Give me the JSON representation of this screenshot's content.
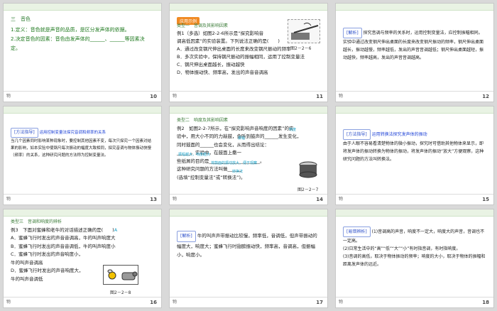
{
  "slides": [
    {
      "num": "10",
      "foot": "物",
      "section": "三　音色",
      "lines": [
        "1.定义：音色就是声音的品质，是区分发声体的依据。",
        "2.决定音色的因素：音色由发声体的______、______等因素决定。"
      ]
    },
    {
      "num": "11",
      "foot": "物",
      "tag": "应用示例",
      "subtitle": "类型一　音调及其影响因素",
      "lines": [
        "例1（多选）如图2-2-6所示是“探究影响音",
        "调高低因素”的实验装置。下列说法正确的是(　　)",
        "A．通过改变钢尺伸出桌面的长度来改变钢尺振动的频率",
        "B．多次实验中，保持钢尺振动的振幅相同，运用了控制变量法",
        "C．钢尺伸出桌面越长，振动越快",
        "D．物体振动快、频率高，发出的声音音调高"
      ],
      "figure_label": "图2－2－6"
    },
    {
      "num": "12",
      "foot": "物",
      "label": "[解析]",
      "text": "探究音调与频率的关系时，运用控制变量法，应控制振幅相同。实验中通过改变钢尺伸出桌面的长度来改变钢尺振动的频率，钢尺伸出桌面越长，振动越慢，频率越低，发出的声音音调越低；钢尺伸出桌面越短，振动越快，频率越高，发出的声音音调越高。"
    },
    {
      "num": "13",
      "foot": "物",
      "label": "[方法指导]",
      "title": "运用控制变量法探究音调和频率的关系",
      "text": "当几个因素同时影响某种现象时，要控制其他因素不变，每次只探究一个因素对结果的影响，如本实验中使钢尺每次振动的幅度大致相同，探究音调与物体振动快慢（频率）的关系，这种研究问题的方法称为控制变量法。"
    },
    {
      "num": "14",
      "foot": "物",
      "subtitle": "类型二　响度及其影响因素",
      "lines": [
        "例2　如图2-2-7所示，在“探究影响声音响度的因素”的实",
        "验中，用大小不同的力敲鼓，会听到鼓声的______发生变化，",
        "同时鼓面的______也会变化，从而得出结论：",
        "______。实验中，在鼓面上撒一",
        "些纸屑的目的是______________________。",
        "这种研究问题的方法叫做______",
        "(选填“控制变量法”或“转换法”)。"
      ],
      "answers": [
        "响度",
        "振幅",
        "振幅越大，响度越大",
        "将鼓面的振动放大，便于观察",
        "转换法"
      ],
      "figure_label": "图2－2－7"
    },
    {
      "num": "15",
      "foot": "物",
      "label": "[方法指导]",
      "title": "运用转换法探究发声体的振动",
      "text": "由于人眼不容易看清楚物体的微小振动，探究时可借助其他物体来显示，即将发声体的振动转换为物体的振动，将发声体的振动“放大”方便观察，这种研究问题的方法叫转换法。"
    },
    {
      "num": "16",
      "foot": "物",
      "subtitle": "类型三　音调和响度的辨析",
      "lines": [
        "例3　下面对蜜蜂和老牛的对话描述正确的是(　　)",
        "A．蜜蜂飞行时发出的声音音调高，牛的叫声响度大",
        "B．蜜蜂飞行时发出的声音音调低，牛的叫声响度小",
        "C．蜜蜂飞行时发出的声音响度小，",
        "牛的叫声音调高",
        "D．蜜蜂飞行时发出的声音响度大，",
        "牛的叫声音调低"
      ],
      "answer": "A",
      "figure_label": "图2－2－8"
    },
    {
      "num": "17",
      "foot": "物",
      "label": "[解析]",
      "text": "牛的叫声声带振动比较慢，频率低，音调低，但声带振动的幅度大，响度大；蜜蜂飞行时翅膀振动快，频率高，音调高，但振幅小，响度小。"
    },
    {
      "num": "18",
      "foot": "物",
      "label": "[易错辨析]",
      "lines": [
        "(1)音调高的声音，响度不一定大，响度大的声音，音调也不一定高。",
        "(2)日常生活中的“高”“低”“大”“小”有时指音调，有时指响度。",
        "(3)音调的高低，取决于物体振动的频率；响度的大小，取决于物体的振幅和距离发声体的远近。"
      ]
    }
  ]
}
